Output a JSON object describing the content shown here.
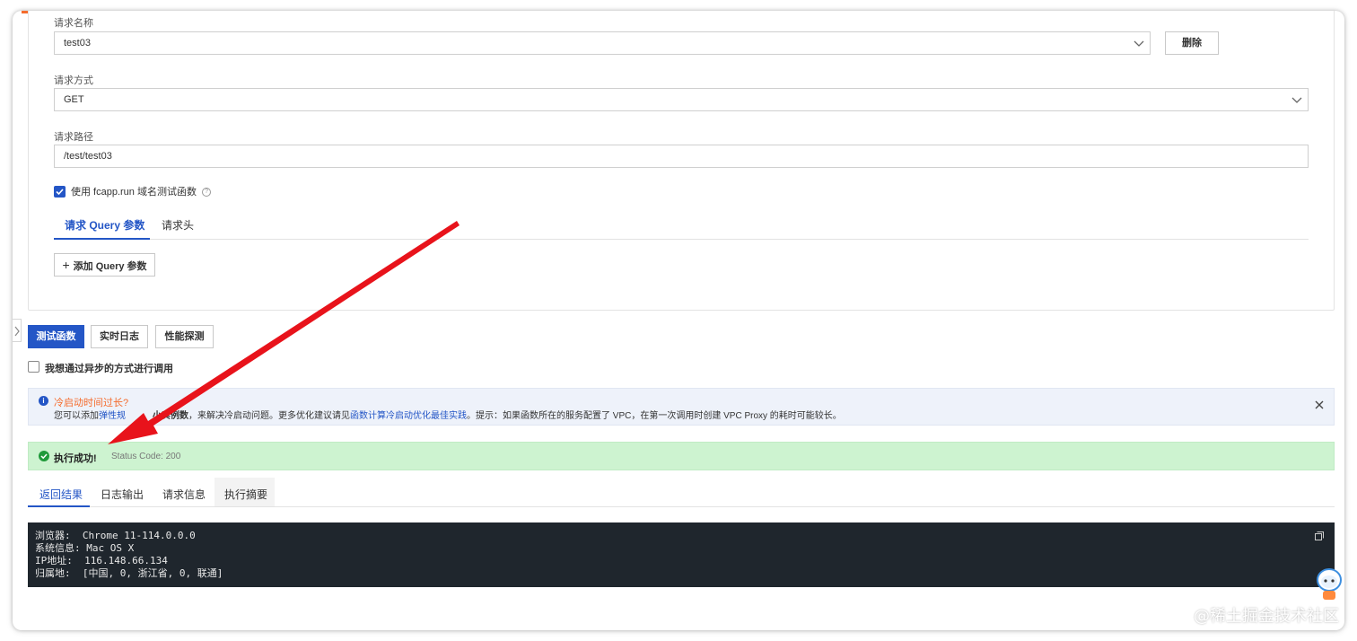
{
  "form": {
    "request_name_label": "请求名称",
    "request_name_value": "test03",
    "delete_label": "删除",
    "method_label": "请求方式",
    "method_value": "GET",
    "path_label": "请求路径",
    "path_value": "/test/test03",
    "use_domain_label": "使用 fcapp.run 域名测试函数",
    "tabs": [
      {
        "label": "请求 Query 参数",
        "active": true
      },
      {
        "label": "请求头",
        "active": false
      }
    ],
    "add_query_label": "添加 Query 参数"
  },
  "actions": {
    "test_label": "测试函数",
    "logs_label": "实时日志",
    "perf_label": "性能探测",
    "async_label": "我想通过异步的方式进行调用"
  },
  "info": {
    "title": "冷启动时间过长?",
    "text_1": "您可以添加",
    "link_1": "弹性规",
    "text_1b": "小实例数",
    "text_2": "，来解决冷启动问题。更多优化建议请见",
    "link_2": "函数计算冷启动优化最佳实践",
    "text_3": "。提示：如果函数所在的服务配置了 VPC，在第一次调用时创建 VPC Proxy 的耗时可能较长。"
  },
  "status": {
    "success_label": "执行成功!",
    "code_text": "Status Code: 200"
  },
  "result_tabs": [
    {
      "label": "返回结果",
      "active": true
    },
    {
      "label": "日志输出",
      "active": false
    },
    {
      "label": "请求信息",
      "active": false
    },
    {
      "label": "执行摘要",
      "active": false
    }
  ],
  "result_lines": [
    "浏览器:  Chrome 11-114.0.0.0",
    "系统信息: Mac OS X",
    "IP地址:  116.148.66.134",
    "归属地:  [中国, 0, 浙江省, 0, 联通]"
  ],
  "watermark": "@稀土掘金技术社区",
  "colors": {
    "primary": "#2456c6",
    "success_bg": "#cdf3d0",
    "info_bg": "#eef2fa",
    "arrow": "#e8131b",
    "console_bg": "#1f262d"
  }
}
